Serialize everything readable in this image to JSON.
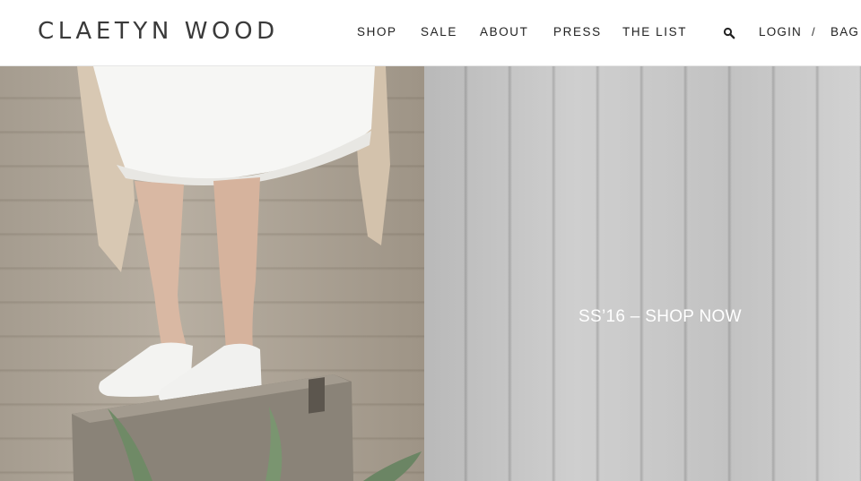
{
  "brand": {
    "logo_text": "CLAETYN WOOD"
  },
  "nav": {
    "items": [
      {
        "label": "SHOP"
      },
      {
        "label": "SALE"
      },
      {
        "label": "ABOUT"
      },
      {
        "label": "PRESS"
      },
      {
        "label": "THE LIST"
      }
    ]
  },
  "account": {
    "login_label": "LOGIN",
    "separator": "/",
    "bag_label": "BAG"
  },
  "icons": {
    "search": "search-icon"
  },
  "hero": {
    "cta_label": "SS’16 – SHOP NOW"
  },
  "colors": {
    "header_bg": "#ffffff",
    "text": "#222222",
    "cta_text": "#ffffff"
  }
}
